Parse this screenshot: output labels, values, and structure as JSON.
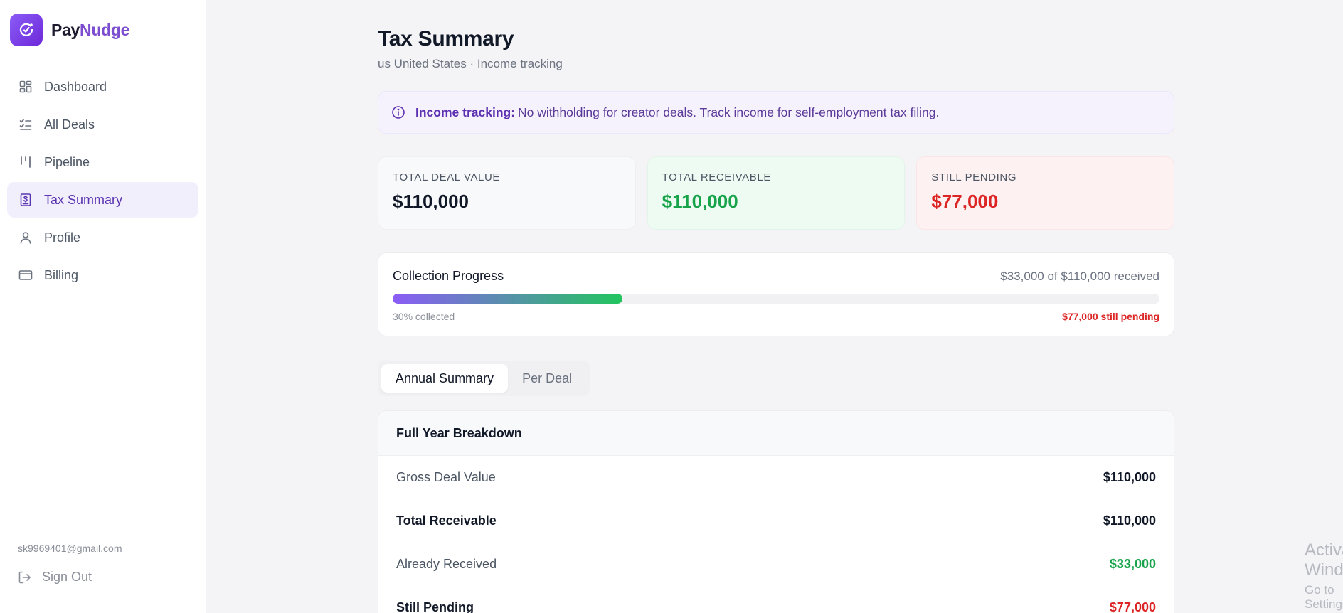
{
  "brand": {
    "name_part1": "Pay",
    "name_part2": "Nudge",
    "accent": "#7c4dce"
  },
  "nav": {
    "items": [
      {
        "label": "Dashboard",
        "icon": "grid-icon"
      },
      {
        "label": "All Deals",
        "icon": "checklist-icon"
      },
      {
        "label": "Pipeline",
        "icon": "pipeline-icon"
      },
      {
        "label": "Tax Summary",
        "icon": "receipt-dollar-icon",
        "active": true
      },
      {
        "label": "Profile",
        "icon": "user-icon"
      },
      {
        "label": "Billing",
        "icon": "credit-card-icon"
      }
    ]
  },
  "user": {
    "email": "sk9969401@gmail.com",
    "sign_out": "Sign Out"
  },
  "page": {
    "title": "Tax Summary",
    "subtitle": "us United States · Income tracking"
  },
  "banner": {
    "strong": "Income tracking:",
    "text": "No withholding for creator deals. Track income for self-employment tax filing."
  },
  "stats": [
    {
      "label": "TOTAL DEAL VALUE",
      "value": "$110,000"
    },
    {
      "label": "TOTAL RECEIVABLE",
      "value": "$110,000"
    },
    {
      "label": "STILL PENDING",
      "value": "$77,000"
    }
  ],
  "progress": {
    "title": "Collection Progress",
    "received_text": "$33,000 of $110,000 received",
    "percent": 30,
    "percent_text": "30% collected",
    "pending_text": "$77,000 still pending"
  },
  "tabs": [
    "Annual Summary",
    "Per Deal"
  ],
  "breakdown": {
    "title": "Full Year Breakdown",
    "rows": [
      {
        "label": "Gross Deal Value",
        "value": "$110,000"
      },
      {
        "label": "Total Receivable",
        "value": "$110,000"
      },
      {
        "label": "Already Received",
        "value": "$33,000"
      },
      {
        "label": "Still Pending",
        "value": "$77,000"
      }
    ]
  },
  "watermark": {
    "title": "Activate Windows",
    "subtitle": "Go to Settings to activate Windows."
  },
  "colors": {
    "positive": "#16a34a",
    "negative": "#dc2626",
    "active_nav_bg": "#f2effd"
  }
}
